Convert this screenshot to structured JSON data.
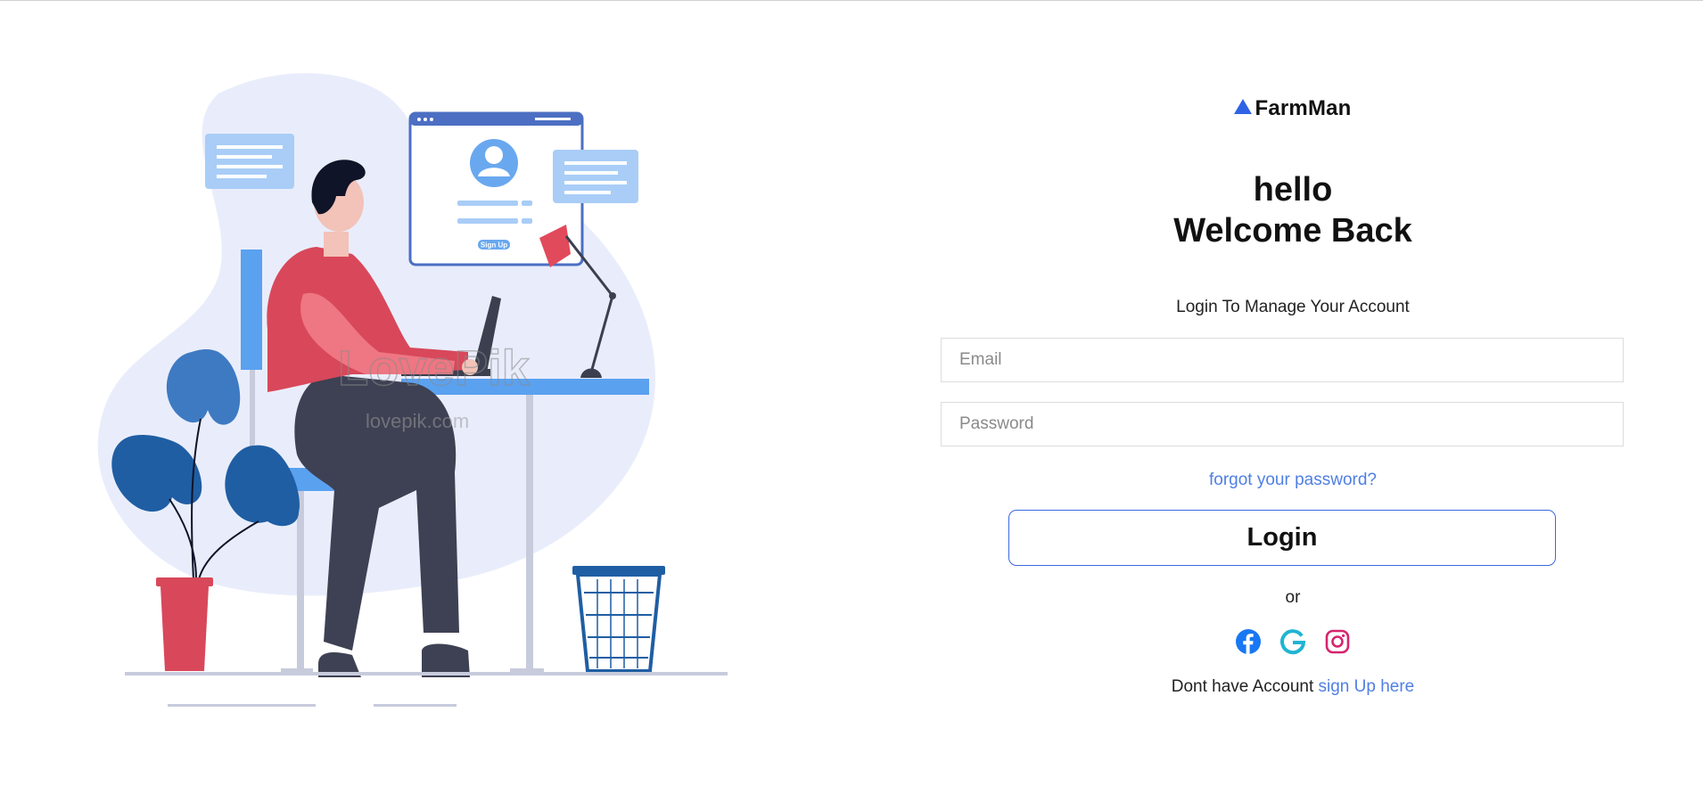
{
  "brand": {
    "name": "FarmMan",
    "icon": "triangle-logo-icon",
    "color": "#2f63e6"
  },
  "heading": {
    "line1": "hello",
    "line2": "Welcome Back"
  },
  "subtitle": "Login To Manage Your Account",
  "form": {
    "email_placeholder": "Email",
    "password_placeholder": "Password",
    "forgot_label": "forgot your password?",
    "login_label": "Login"
  },
  "divider_label": "or",
  "social": [
    {
      "name": "facebook-icon",
      "color": "#1877f2"
    },
    {
      "name": "google-icon",
      "color": "#20b4d2"
    },
    {
      "name": "instagram-icon",
      "color": "#d6246e"
    }
  ],
  "signup": {
    "prompt": "Dont have Account",
    "link_label": "sign Up here"
  },
  "illustration": {
    "screen_button_label": "Sign Up",
    "watermark": "LovePik",
    "watermark_url": "lovepik.com"
  },
  "colors": {
    "accent": "#4f7fe3",
    "button_border": "#3c68e0"
  }
}
